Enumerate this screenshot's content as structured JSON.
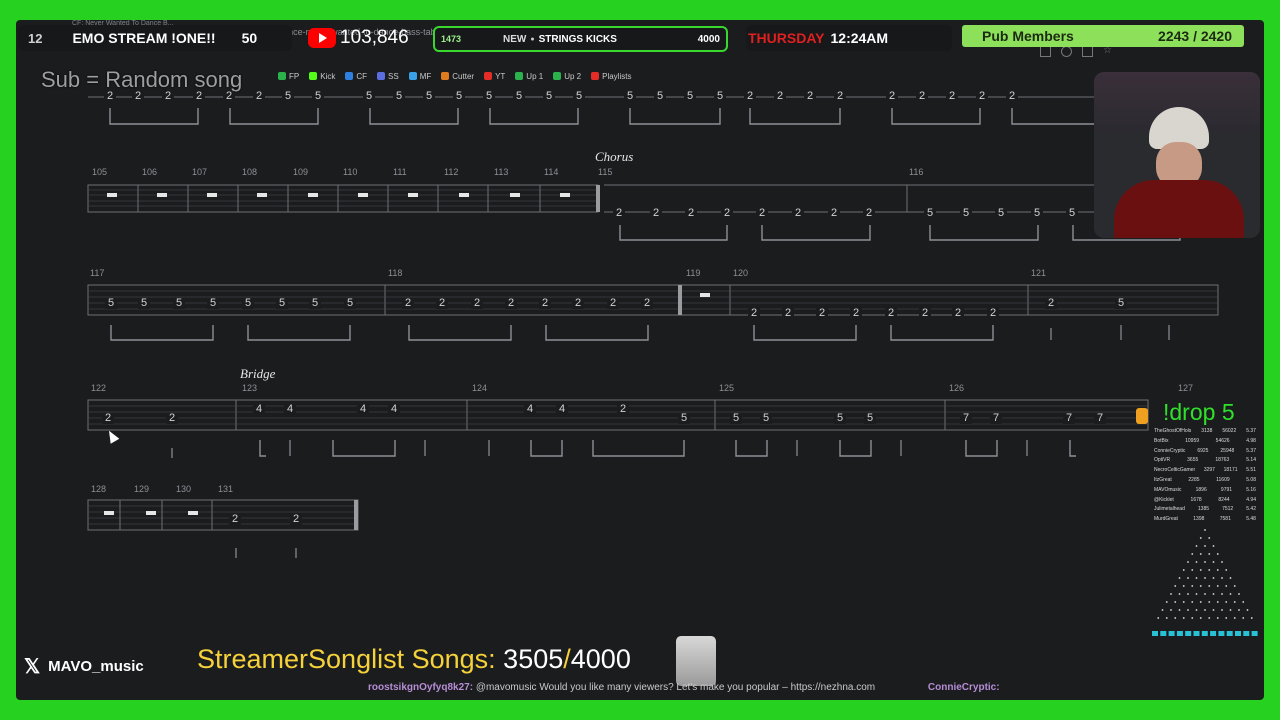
{
  "browser": {
    "tab_title": "CF: Never Wanted To Dance B...",
    "url": "https://www.songsterr.com/a/wsa/mindless-self-indulgence-never-wanted-to-dance-bass-tab-s43513?open=editor",
    "bookmarks": [
      {
        "label": "FP",
        "color": "#2bb24c"
      },
      {
        "label": "Kick",
        "color": "#53fc18"
      },
      {
        "label": "CF",
        "color": "#2f7fe0"
      },
      {
        "label": "SS",
        "color": "#5a6ee0"
      },
      {
        "label": "MF",
        "color": "#3aa0e8"
      },
      {
        "label": "Cutter",
        "color": "#e07a1f"
      },
      {
        "label": "YT",
        "color": "#e52d27"
      },
      {
        "label": "Up 1",
        "color": "#2bb24c"
      },
      {
        "label": "Up 2",
        "color": "#2bb24c"
      },
      {
        "label": "Playlists",
        "color": "#e52d27"
      }
    ]
  },
  "overlay": {
    "channel_number": "12",
    "stream_title": "EMO STREAM !ONE!!",
    "stream_count": "50",
    "youtube_subs": "103,846",
    "goal_left": "1473",
    "goal_label": "NEW",
    "goal_text": "STRINGS KICKS",
    "goal_target": "4000",
    "day": "THURSDAY",
    "time": "12:24AM",
    "members_label": "Pub Members",
    "members_value": "2243 / 2420",
    "sub_prompt": "Sub = Random song",
    "drop_command": "!drop 5",
    "twitter_handle": "MAVO_music",
    "songlist_label": "StreamerSonglist Songs:",
    "songlist_current": "3505",
    "songlist_sep": "/",
    "songlist_total": "4000",
    "ticker_user": "roostsikgnOyfyq8k27:",
    "ticker_text": "@mavomusic Would you like many viewers? Let's make you popular – https://nezhna.com",
    "ticker_user2": "ConnieCryptic:"
  },
  "leaderboard": [
    {
      "name": "TheGhostOfHols",
      "pts": "3138",
      "val": "56022",
      "avg": "5.37"
    },
    {
      "name": "BotBix",
      "pts": "10959",
      "val": "54626",
      "avg": "4.98"
    },
    {
      "name": "ConnieCryptic",
      "pts": "6925",
      "val": "25948",
      "avg": "5.37"
    },
    {
      "name": "OptiVR",
      "pts": "3655",
      "val": "18763",
      "avg": "5.14"
    },
    {
      "name": "NecroCelticGamer",
      "pts": "3297",
      "val": "18171",
      "avg": "5.51"
    },
    {
      "name": "ItzGreat",
      "pts": "2285",
      "val": "11609",
      "avg": "5.08"
    },
    {
      "name": "MAVOmusic",
      "pts": "1896",
      "val": "9791",
      "avg": "5.16"
    },
    {
      "name": "@Kicklet",
      "pts": "1678",
      "val": "8244",
      "avg": "4.94"
    },
    {
      "name": "Julimetalhead",
      "pts": "1385",
      "val": "7512",
      "avg": "5.42"
    },
    {
      "name": "MurdGreat",
      "pts": "1398",
      "val": "7581",
      "avg": "5.48"
    }
  ],
  "tab": {
    "sections": {
      "chorus": "Chorus",
      "bridge": "Bridge"
    },
    "row0_notes": [
      "2",
      "2",
      "2",
      "2",
      "2",
      "2",
      "5",
      "5",
      "5",
      "5",
      "5",
      "5",
      "5",
      "5",
      "5",
      "5",
      "5",
      "5",
      "5",
      "5",
      "2",
      "2",
      "2",
      "2",
      "2",
      "2",
      "2",
      "2",
      "2"
    ],
    "row1_measures": [
      "105",
      "106",
      "107",
      "108",
      "109",
      "110",
      "111",
      "112",
      "113",
      "114",
      "115",
      "116"
    ],
    "row1_notes": [
      "2",
      "2",
      "2",
      "2",
      "2",
      "2",
      "2",
      "2",
      "5",
      "5",
      "5",
      "5",
      "5",
      "5"
    ],
    "row2_measures": [
      "117",
      "118",
      "119",
      "120",
      "121"
    ],
    "row2_notes": [
      "5",
      "5",
      "5",
      "5",
      "5",
      "5",
      "5",
      "5",
      "2",
      "2",
      "2",
      "2",
      "2",
      "2",
      "2",
      "2",
      "2",
      "2",
      "2",
      "2",
      "2",
      "2",
      "2",
      "2",
      "2",
      "5",
      "5"
    ],
    "row3_measures": [
      "122",
      "123",
      "124",
      "125",
      "126",
      "127"
    ],
    "row3_notes": [
      "2",
      "2",
      "4",
      "4",
      "4",
      "4",
      "4",
      "4",
      "2",
      "5",
      "5",
      "5",
      "5",
      "5",
      "7",
      "7",
      "7",
      "7"
    ],
    "row4_measures": [
      "128",
      "129",
      "130",
      "131"
    ],
    "row4_notes": [
      "2",
      "2"
    ]
  }
}
